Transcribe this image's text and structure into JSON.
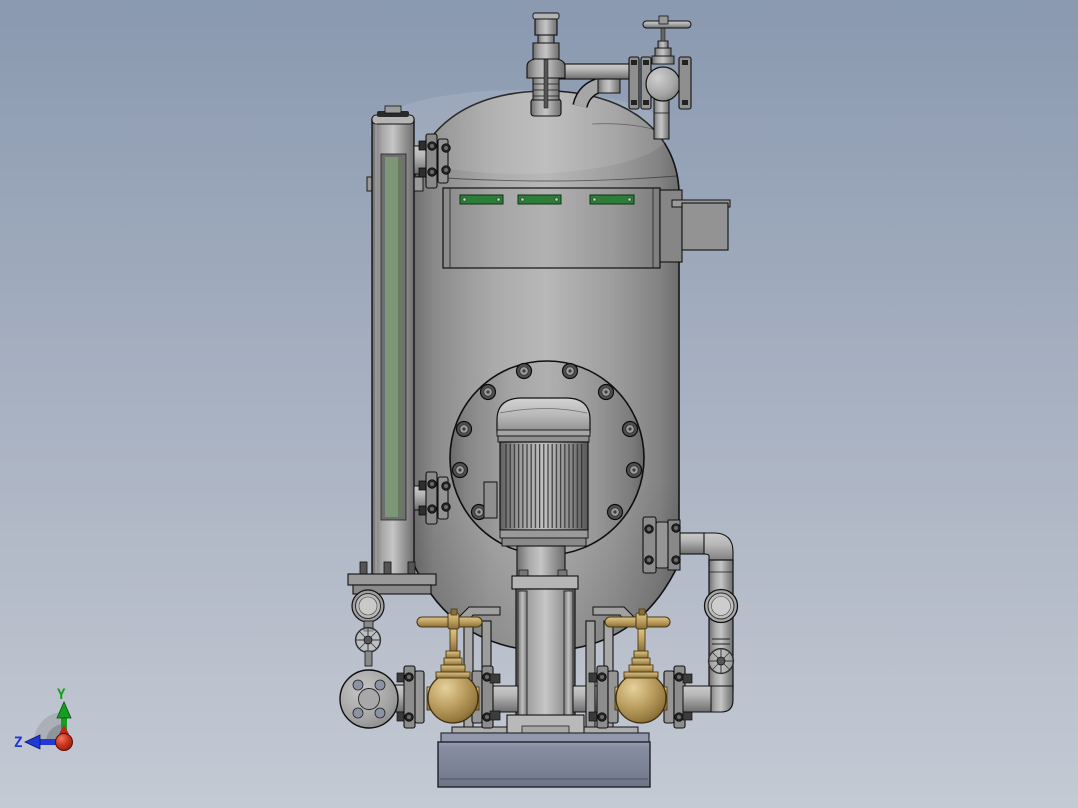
{
  "viewport": {
    "scene_label": "pressure-vessel-pump-assembly",
    "background_top": "#8a99b0",
    "background_bottom": "#c4cad4"
  },
  "triad": {
    "y_label": "Y",
    "z_label": "Z",
    "y_color": "#14a01e",
    "z_color": "#2238d8",
    "origin_color": "#c22315"
  },
  "colors": {
    "vessel_gray": "#b0b0b0",
    "edge_black": "#141414",
    "nameplate_green": "#2e7c3a",
    "gauge_green": "#7d9677",
    "brass": "#bd9f60",
    "base_plate": "#7d8397"
  },
  "components": {
    "vessel": "pressure vessel",
    "sight_glass": "level gauge sight glass",
    "safety_valve": "safety relief valve",
    "top_globe_valve": "globe valve with handwheel",
    "nameplate_panel": "nameplate panel",
    "junction_box": "junction box",
    "manway": "manway flange",
    "motor": "electric motor",
    "pump_column": "pump column",
    "brass_valve_left": "bronze globe valve",
    "brass_valve_right": "bronze globe valve",
    "blind_flange": "blind flange",
    "drain_sight_glass": "drain sight glass",
    "discharge_pipe": "discharge pipe",
    "base": "base plate"
  }
}
